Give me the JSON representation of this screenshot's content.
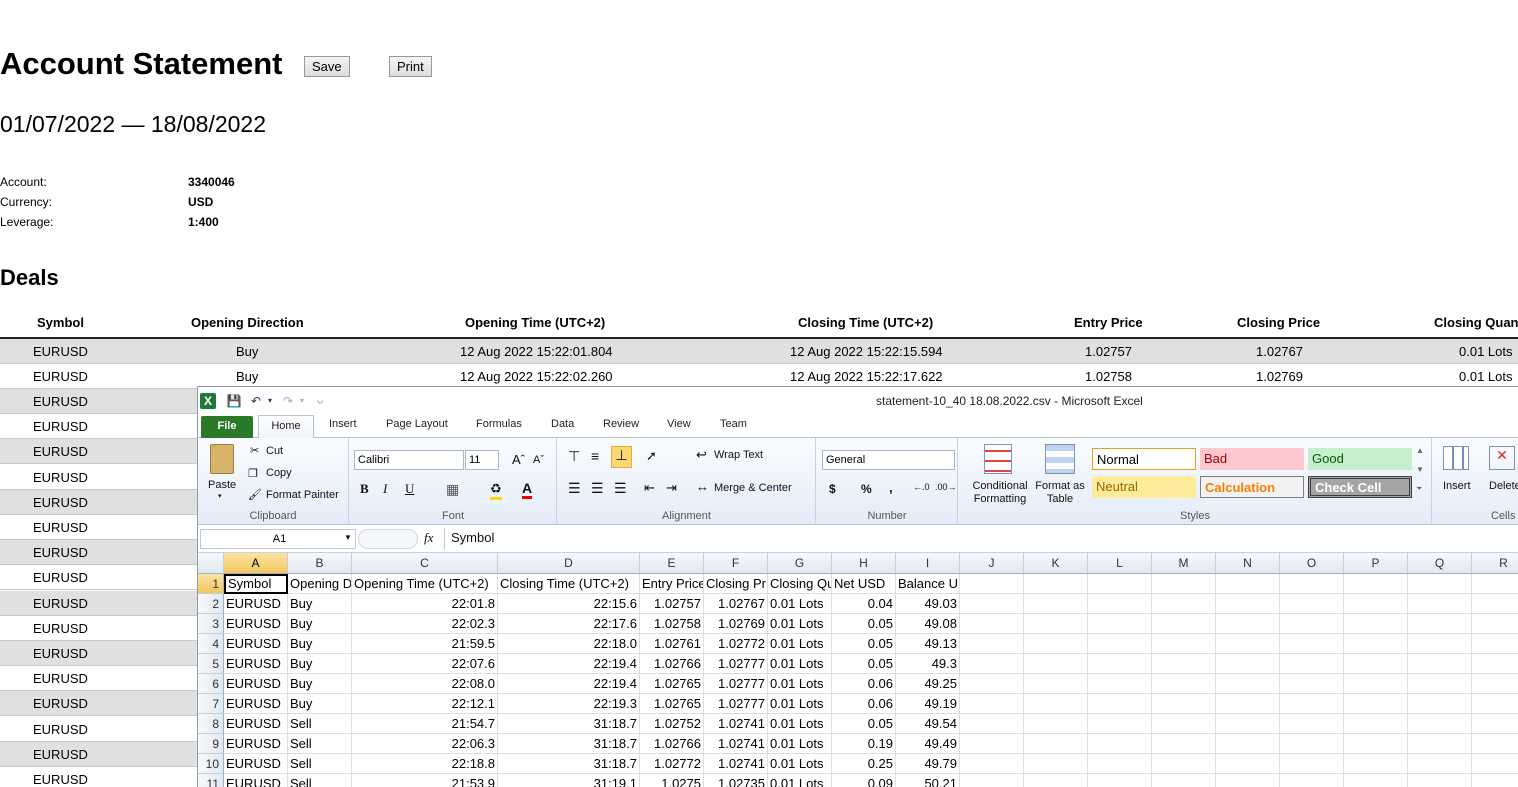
{
  "report": {
    "title": "Account Statement",
    "save_label": "Save",
    "print_label": "Print",
    "date_range": "01/07/2022 — 18/08/2022",
    "account_label": "Account:",
    "account_value": "3340046",
    "currency_label": "Currency:",
    "currency_value": "USD",
    "leverage_label": "Leverage:",
    "leverage_value": "1:400",
    "deals_heading": "Deals",
    "columns": [
      "Symbol",
      "Opening Direction",
      "Opening Time (UTC+2)",
      "Closing Time (UTC+2)",
      "Entry Price",
      "Closing Price",
      "Closing Quan"
    ],
    "rows": [
      {
        "symbol": "EURUSD",
        "dir": "Buy",
        "open": "12 Aug 2022 15:22:01.804",
        "close": "12 Aug 2022 15:22:15.594",
        "entry": "1.02757",
        "closep": "1.02767",
        "qty": "0.01 Lots"
      },
      {
        "symbol": "EURUSD",
        "dir": "Buy",
        "open": "12 Aug 2022 15:22:02.260",
        "close": "12 Aug 2022 15:22:17.622",
        "entry": "1.02758",
        "closep": "1.02769",
        "qty": "0.01 Lots"
      }
    ],
    "hidden_symbols": [
      "EURUSD",
      "EURUSD",
      "EURUSD",
      "EURUSD",
      "EURUSD",
      "EURUSD",
      "EURUSD",
      "EURUSD",
      "EURUSD",
      "EURUSD",
      "EURUSD",
      "EURUSD",
      "EURUSD",
      "EURUSD",
      "EURUSD",
      "EURUSD",
      "EURUSD"
    ]
  },
  "excel": {
    "window_title": "statement-10_40 18.08.2022.csv  -  Microsoft Excel",
    "tabs": [
      "File",
      "Home",
      "Insert",
      "Page Layout",
      "Formulas",
      "Data",
      "Review",
      "View",
      "Team"
    ],
    "clipboard": {
      "paste": "Paste",
      "cut": "Cut",
      "copy": "Copy",
      "format_painter": "Format Painter",
      "label": "Clipboard"
    },
    "font": {
      "name": "Calibri",
      "size": "11",
      "label": "Font",
      "bold": "B",
      "italic": "I",
      "underline": "U"
    },
    "alignment": {
      "wrap": "Wrap Text",
      "merge": "Merge & Center",
      "label": "Alignment"
    },
    "number": {
      "format": "General",
      "currency": "$",
      "percent": "%",
      "comma": ",",
      "label": "Number"
    },
    "styles": {
      "conditional": "Conditional Formatting",
      "format_table": "Format as Table",
      "normal": "Normal",
      "bad": "Bad",
      "good": "Good",
      "neutral": "Neutral",
      "calculation": "Calculation",
      "check_cell": "Check Cell",
      "label": "Styles"
    },
    "cells": {
      "insert": "Insert",
      "delete": "Delete",
      "label": "Cells"
    },
    "name_box": "A1",
    "fx": "fx",
    "formula": "Symbol",
    "col_letters": [
      "A",
      "B",
      "C",
      "D",
      "E",
      "F",
      "G",
      "H",
      "I",
      "J",
      "K",
      "L",
      "M",
      "N",
      "O",
      "P",
      "Q",
      "R"
    ],
    "header_row": [
      "Symbol",
      "Opening D",
      "Opening Time (UTC+2)",
      "Closing Time (UTC+2)",
      "Entry Price",
      "Closing Pr",
      "Closing Qu",
      "Net USD",
      "Balance USD"
    ],
    "data_rows": [
      [
        "EURUSD",
        "Buy",
        "22:01.8",
        "22:15.6",
        "1.02757",
        "1.02767",
        "0.01 Lots",
        "0.04",
        "49.03"
      ],
      [
        "EURUSD",
        "Buy",
        "22:02.3",
        "22:17.6",
        "1.02758",
        "1.02769",
        "0.01 Lots",
        "0.05",
        "49.08"
      ],
      [
        "EURUSD",
        "Buy",
        "21:59.5",
        "22:18.0",
        "1.02761",
        "1.02772",
        "0.01 Lots",
        "0.05",
        "49.13"
      ],
      [
        "EURUSD",
        "Buy",
        "22:07.6",
        "22:19.4",
        "1.02766",
        "1.02777",
        "0.01 Lots",
        "0.05",
        "49.3"
      ],
      [
        "EURUSD",
        "Buy",
        "22:08.0",
        "22:19.4",
        "1.02765",
        "1.02777",
        "0.01 Lots",
        "0.06",
        "49.25"
      ],
      [
        "EURUSD",
        "Buy",
        "22:12.1",
        "22:19.3",
        "1.02765",
        "1.02777",
        "0.01 Lots",
        "0.06",
        "49.19"
      ],
      [
        "EURUSD",
        "Sell",
        "21:54.7",
        "31:18.7",
        "1.02752",
        "1.02741",
        "0.01 Lots",
        "0.05",
        "49.54"
      ],
      [
        "EURUSD",
        "Sell",
        "22:06.3",
        "31:18.7",
        "1.02766",
        "1.02741",
        "0.01 Lots",
        "0.19",
        "49.49"
      ],
      [
        "EURUSD",
        "Sell",
        "22:18.8",
        "31:18.7",
        "1.02772",
        "1.02741",
        "0.01 Lots",
        "0.25",
        "49.79"
      ],
      [
        "EURUSD",
        "Sell",
        "21:53.9",
        "31:19.1",
        "1.0275",
        "1.02735",
        "0.01 Lots",
        "0.09",
        "50.21"
      ]
    ]
  }
}
